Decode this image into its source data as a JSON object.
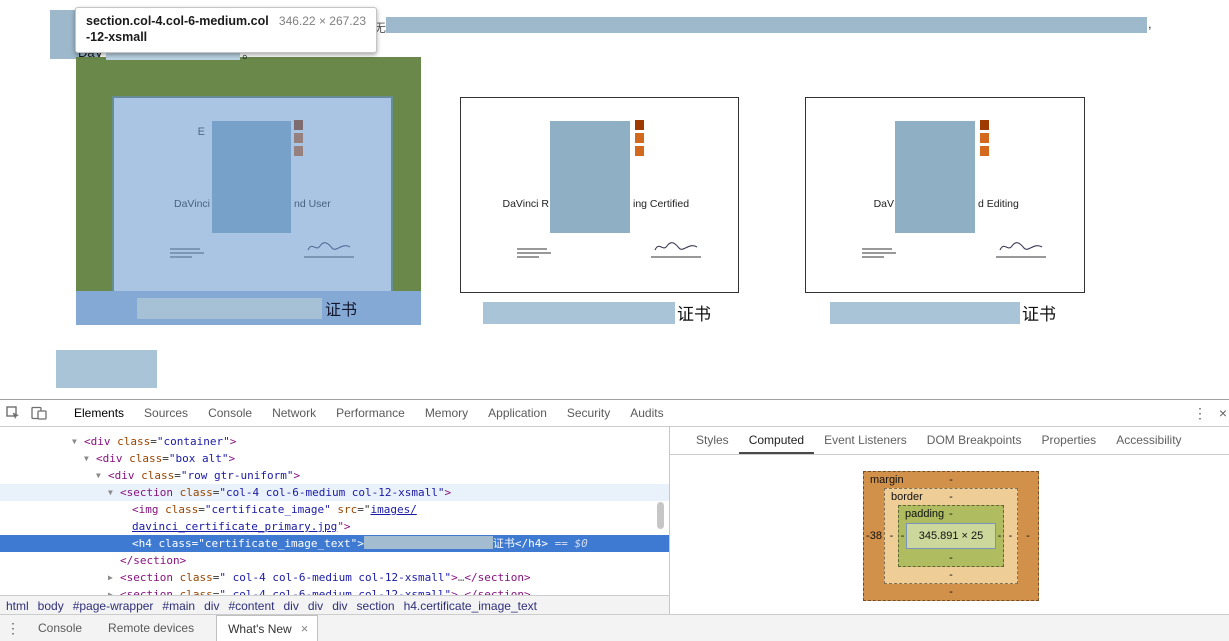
{
  "page": {
    "heading": {
      "prefix": "DaV",
      "suffix": "。"
    },
    "pre_bar_char": "无",
    "bar_trailing": ",",
    "tooltip": {
      "selector": "section.col-4.col-6-medium.col-12-xsmall",
      "dimensions": "346.22 × 267.23"
    },
    "certificates": [
      {
        "left_text": "DaVinci",
        "right_text": "nd User",
        "extra_text": "E",
        "caption_suffix": "证书"
      },
      {
        "left_text": "DaVinci R",
        "right_text": "ing Certified",
        "caption_suffix": "证书"
      },
      {
        "left_text": "DaV",
        "right_text": "d Editing",
        "caption_suffix": "证书"
      }
    ]
  },
  "devtools": {
    "main_tabs": [
      "Elements",
      "Sources",
      "Console",
      "Network",
      "Performance",
      "Memory",
      "Application",
      "Security",
      "Audits"
    ],
    "sidebar_tabs": [
      "Styles",
      "Computed",
      "Event Listeners",
      "DOM Breakpoints",
      "Properties",
      "Accessibility"
    ],
    "icons": {
      "arrow_down": "▼",
      "arrow_right": "▶",
      "more": "⋮",
      "close": "×",
      "drawer_menu": "⋮",
      "tab_close": "×"
    },
    "tree": {
      "r1": {
        "open": "<div",
        "attr": " class",
        "eq": "=",
        "val": "\"container\"",
        "close": ">"
      },
      "r2": {
        "open": "<div",
        "attr": " class",
        "eq": "=",
        "val": "\"box alt\"",
        "close": ">"
      },
      "r3": {
        "open": "<div",
        "attr": " class",
        "eq": "=",
        "val": "\"row gtr-uniform\"",
        "close": ">"
      },
      "r4": {
        "open": "<section",
        "attr": " class",
        "eq": "=",
        "val": "\"col-4 col-6-medium col-12-xsmall\"",
        "close": ">"
      },
      "r5": {
        "open": "<img",
        "attr": " class",
        "eq": "=",
        "val": "\"certificate_image\"",
        "attr2": " src",
        "eq2": "=\"",
        "link": "images/"
      },
      "r6": {
        "link": "davinci_certificate_primary.jpg",
        "close": "\">"
      },
      "r7": {
        "open": "<h4",
        "attr": " class",
        "eq": "=",
        "val": "\"certificate_image_text\"",
        "close": ">",
        "text": "证书",
        "end": "</h4>",
        "flag": "== $0"
      },
      "r8": {
        "end": "</section>"
      },
      "r9": {
        "open": "<section",
        "attr": " class",
        "eq": "=",
        "val": "\" col-4 col-6-medium col-12-xsmall\"",
        "close": ">",
        "ellipsis": "…",
        "end": "</section>"
      },
      "r10": {
        "open": "<section",
        "attr": " class",
        "eq": "=",
        "val": "\" col-4 col-6-medium col-12-xsmall\"",
        "close": ">",
        "ellipsis": "…",
        "end": "</section>"
      }
    },
    "breadcrumbs": [
      "html",
      "body",
      "#page-wrapper",
      "#main",
      "div",
      "#content",
      "div",
      "div",
      "div",
      "section",
      "h4.certificate_image_text"
    ],
    "box_model": {
      "margin_label": "margin",
      "border_label": "border",
      "padding_label": "padding",
      "margin": {
        "top": "-",
        "right": "-",
        "bottom": "-",
        "left": "-38"
      },
      "border": {
        "top": "-",
        "right": "-",
        "bottom": "-",
        "left": "-"
      },
      "padding": {
        "top": "-",
        "right": "-",
        "bottom": "-",
        "left": "-"
      },
      "content": "345.891 × 25"
    },
    "drawer": {
      "console": "Console",
      "remote": "Remote devices",
      "active_tab": "What's New"
    }
  }
}
